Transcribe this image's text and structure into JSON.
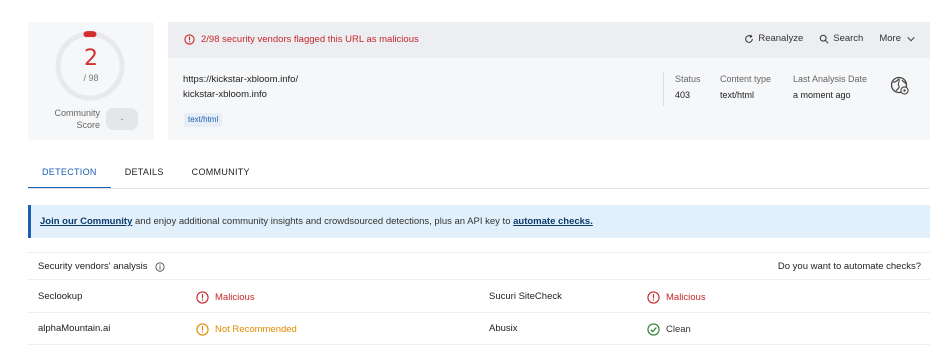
{
  "score": {
    "detections": "2",
    "total": "/ 98",
    "community_label": "Community Score",
    "community_value": "-",
    "gauge_fraction": 0.0204,
    "color": "#d32f2f"
  },
  "alert": {
    "text": "2/98 security vendors flagged this URL as malicious",
    "icon": "alert-circle-icon"
  },
  "actions": {
    "reanalyze": "Reanalyze",
    "search": "Search",
    "more": "More"
  },
  "target": {
    "url": "https://kickstar-xbloom.info/",
    "host": "kickstar-xbloom.info",
    "tag": "text/html"
  },
  "meta": {
    "status_label": "Status",
    "status_value": "403",
    "content_type_label": "Content type",
    "content_type_value": "text/html",
    "last_analysis_label": "Last Analysis Date",
    "last_analysis_value": "a moment ago"
  },
  "tabs": [
    "DETECTION",
    "DETAILS",
    "COMMUNITY"
  ],
  "banner": {
    "link1": "Join our Community",
    "middle": " and enjoy additional community insights and crowdsourced detections, plus an API key to ",
    "link2": "automate checks."
  },
  "vendors": {
    "title": "Security vendors' analysis",
    "automate_question": "Do you want to automate checks?",
    "rows": [
      {
        "vendor1": "Seclookup",
        "result1": "Malicious",
        "vendor2": "Sucuri SiteCheck",
        "result2": "Malicious"
      },
      {
        "vendor1": "alphaMountain.ai",
        "result1": "Not Recommended",
        "vendor2": "Abusix",
        "result2": "Clean"
      }
    ]
  },
  "colors": {
    "accent": "#1a5fb4",
    "malicious": "#c62828",
    "warning": "#e08a00",
    "clean": "#2e7d32"
  }
}
